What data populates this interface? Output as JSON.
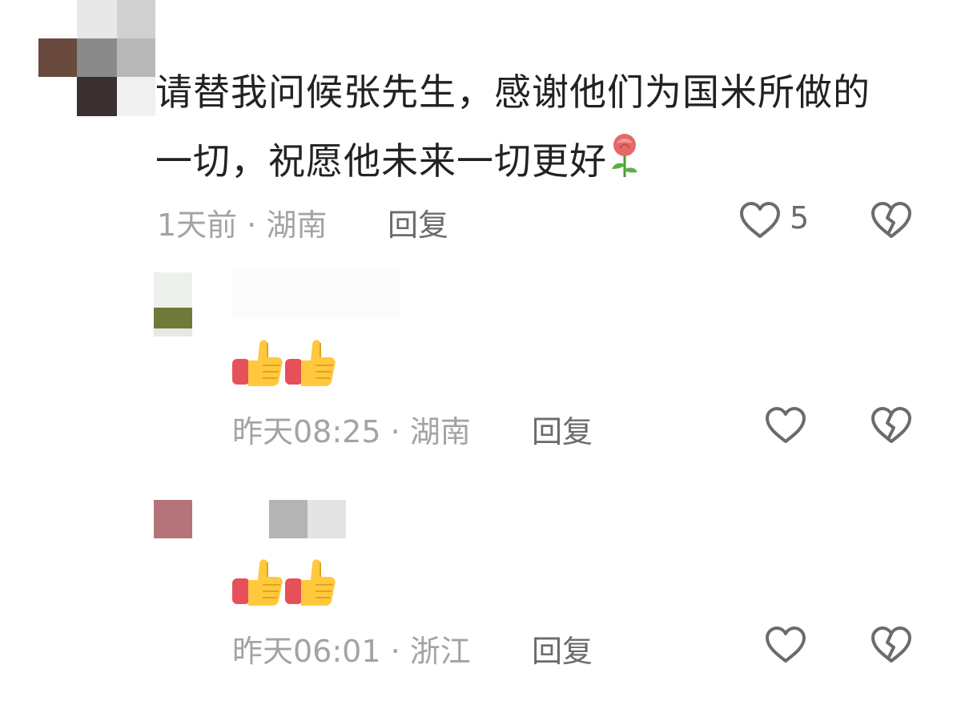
{
  "colors": {
    "text_primary": "#222222",
    "meta_text": "#a3a3a3",
    "action_text": "#6b6b6b",
    "icon_stroke": "#6b6b6b"
  },
  "top_comment": {
    "text_line1": "请替我问候张先生，感谢他们为国米所做的",
    "text_line2": "一切，祝愿他未来一切更好",
    "emoji": "rose-emoji",
    "time_location": "1天前 · 湖南",
    "reply_label": "回复",
    "like_count": "5"
  },
  "replies": [
    {
      "emoji": "thumbs-up-emoji-x2",
      "time_location": "昨天08:25 · 湖南",
      "reply_label": "回复"
    },
    {
      "emoji": "thumbs-up-emoji-x2",
      "time_location": "昨天06:01 · 浙江",
      "reply_label": "回复"
    }
  ],
  "icons": {
    "like": "heart-outline-icon",
    "dislike": "broken-heart-icon"
  }
}
